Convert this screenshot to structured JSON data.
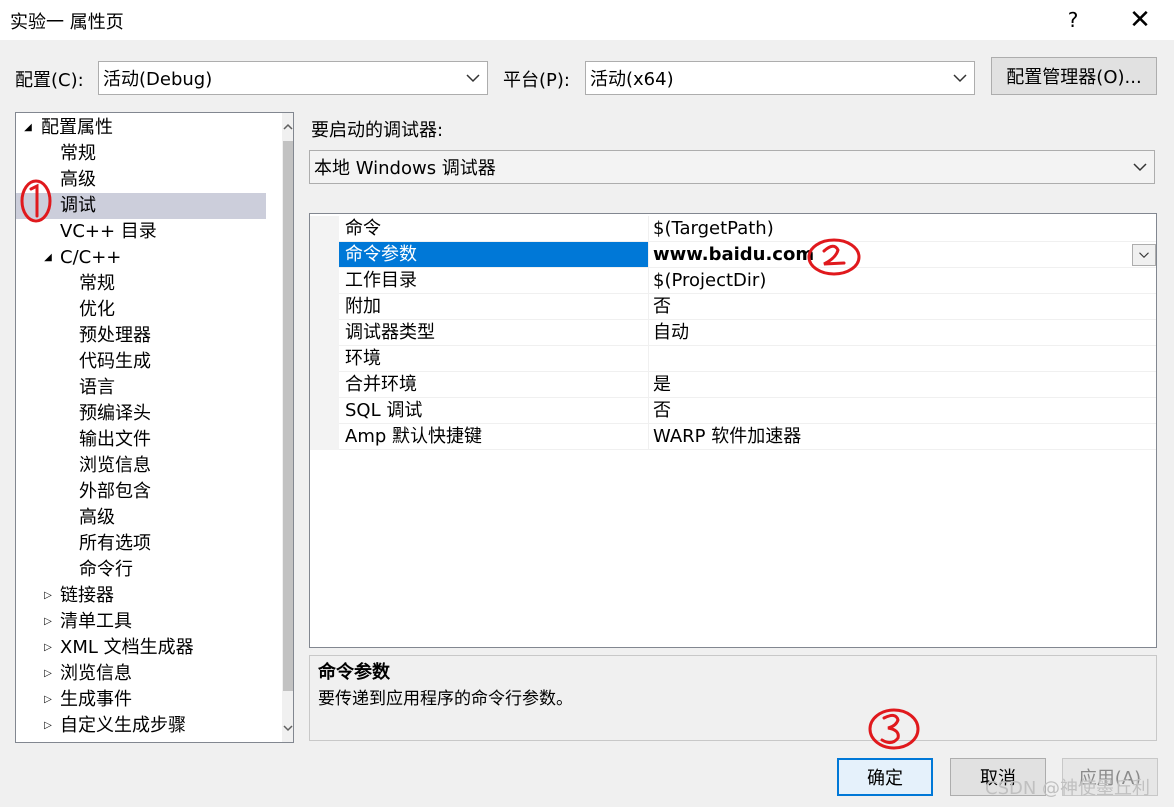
{
  "window": {
    "title": "实验一 属性页",
    "help": "?",
    "close": "✕"
  },
  "top": {
    "config_label": "配置(C):",
    "config_value": "活动(Debug)",
    "platform_label": "平台(P):",
    "platform_value": "活动(x64)",
    "config_manager": "配置管理器(O)..."
  },
  "tree": {
    "root": "配置属性",
    "general": "常规",
    "advanced": "高级",
    "debugging": "调试",
    "vc_dirs": "VC++ 目录",
    "cpp": "C/C++",
    "cpp_items": [
      "常规",
      "优化",
      "预处理器",
      "代码生成",
      "语言",
      "预编译头",
      "输出文件",
      "浏览信息",
      "外部包含",
      "高级",
      "所有选项",
      "命令行"
    ],
    "linker": "链接器",
    "manifest": "清单工具",
    "xml": "XML 文档生成器",
    "browse": "浏览信息",
    "build_events": "生成事件",
    "custom_build": "自定义生成步骤"
  },
  "debugger": {
    "label": "要启动的调试器:",
    "value": "本地 Windows 调试器"
  },
  "grid": {
    "rows": [
      {
        "name": "命令",
        "value": "$(TargetPath)"
      },
      {
        "name": "命令参数",
        "value": "www.baidu.com"
      },
      {
        "name": "工作目录",
        "value": "$(ProjectDir)"
      },
      {
        "name": "附加",
        "value": "否"
      },
      {
        "name": "调试器类型",
        "value": "自动"
      },
      {
        "name": "环境",
        "value": ""
      },
      {
        "name": "合并环境",
        "value": "是"
      },
      {
        "name": "SQL 调试",
        "value": "否"
      },
      {
        "name": "Amp 默认快捷键",
        "value": "WARP 软件加速器"
      }
    ]
  },
  "description": {
    "title": "命令参数",
    "text": "要传递到应用程序的命令行参数。"
  },
  "buttons": {
    "ok": "确定",
    "cancel": "取消",
    "apply": "应用(A)"
  },
  "watermark": "CSDN @神使墨丘利",
  "colors": {
    "selection": "#0078d7",
    "tree_selection": "#cccedb",
    "annotation": "#e0191d"
  }
}
